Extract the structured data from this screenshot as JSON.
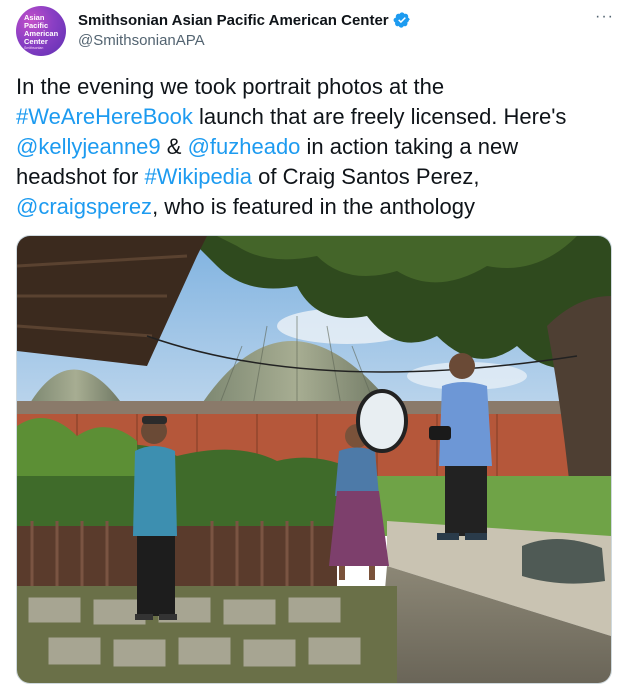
{
  "account": {
    "avatar_text": "Asian Pacific American Center",
    "avatar_subtext": "Smithsonian",
    "display_name": "Smithsonian Asian Pacific American Center",
    "handle": "@SmithsonianAPA",
    "verified": true,
    "verified_icon": "verified-badge-icon",
    "more_icon": "more-options-icon",
    "more_label": "···"
  },
  "tweet": {
    "text_1": "In the evening we took portrait photos at the ",
    "hashtag_1": "#WeAreHereBook",
    "text_2": " launch that are freely licensed. Here's ",
    "mention_1": "@kellyjeanne9",
    "text_3": " & ",
    "mention_2": "@fuzheado",
    "text_4": " in action taking a new headshot for ",
    "hashtag_2": "#Wikipedia",
    "text_5": " of Craig Santos Perez, ",
    "mention_3": "@craigsperez",
    "text_6": ", who is featured in the anthology"
  },
  "colors": {
    "link": "#1d9bf0",
    "text": "#0f1419",
    "secondary": "#536471",
    "verified": "#1d9bf0"
  }
}
